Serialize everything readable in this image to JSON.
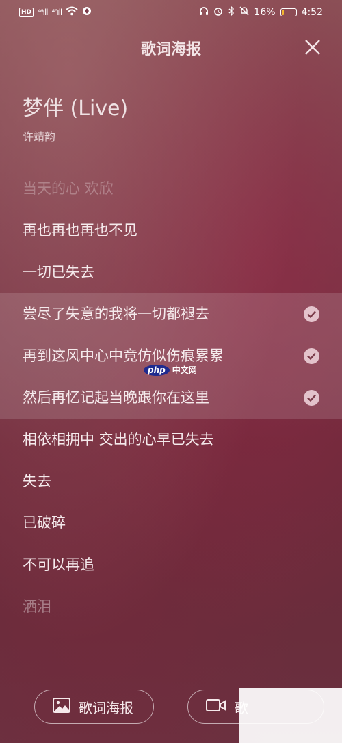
{
  "status_bar": {
    "hd_badge": "HD",
    "signal1": "⁴⁶ıll",
    "signal2": "⁴⁶ıll",
    "battery_text": "16%",
    "time": "4:52",
    "battery_fraction": 0.16
  },
  "header": {
    "title": "歌词海报"
  },
  "song": {
    "title": "梦伴 (Live)",
    "artist": "许靖韵"
  },
  "lyrics": [
    {
      "text": "当天的心 欢欣",
      "selected": false
    },
    {
      "text": "再也再也再也不见",
      "selected": false
    },
    {
      "text": "一切已失去",
      "selected": false
    },
    {
      "text": "尝尽了失意的我将一切都褪去",
      "selected": true
    },
    {
      "text": "再到这风中心中竟仿似伤痕累累",
      "selected": true
    },
    {
      "text": "然后再忆记起当晚跟你在这里",
      "selected": true
    },
    {
      "text": "相依相拥中 交出的心早已失去",
      "selected": false
    },
    {
      "text": "失去",
      "selected": false
    },
    {
      "text": "已破碎",
      "selected": false
    },
    {
      "text": "不可以再追",
      "selected": false
    },
    {
      "text": "洒泪",
      "selected": false
    }
  ],
  "bottom": {
    "poster_label": "歌词海报",
    "video_label": "歌"
  },
  "watermark": {
    "logo": "php",
    "text": "中文网"
  },
  "icons": [
    "close-icon",
    "check-icon",
    "image-icon",
    "video-camera-icon"
  ]
}
